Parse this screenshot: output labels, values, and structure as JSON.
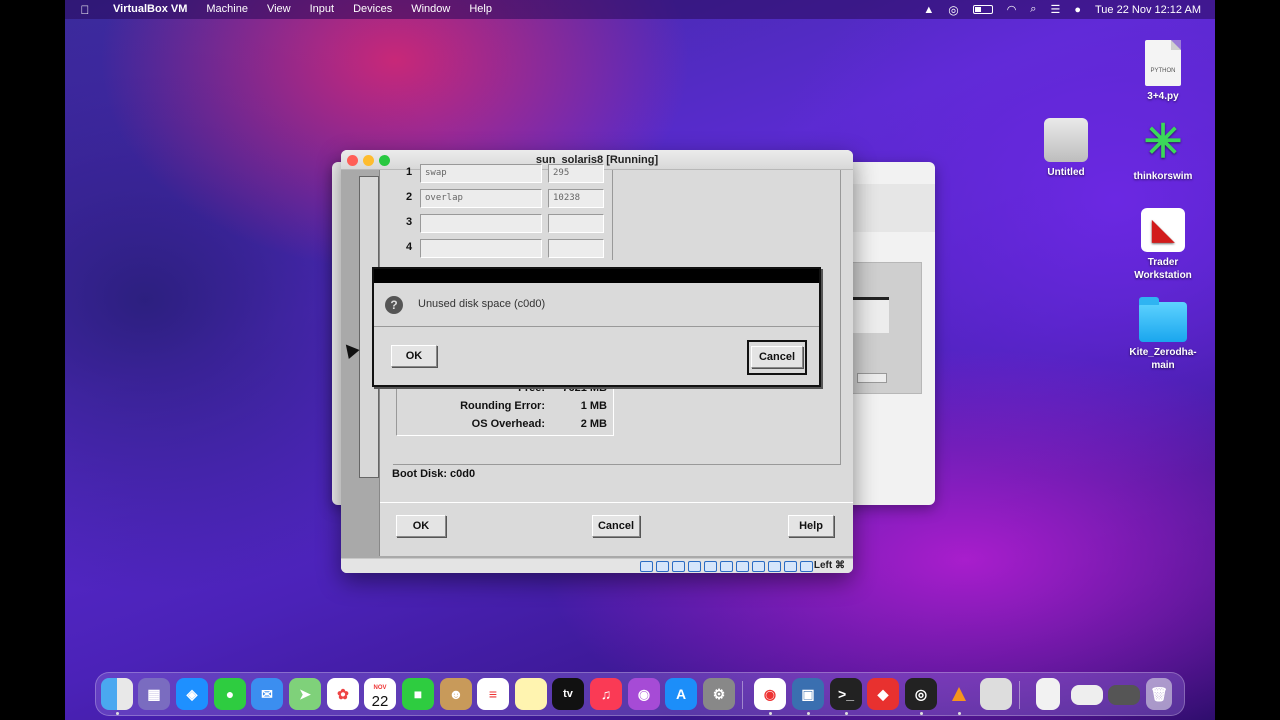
{
  "menubar": {
    "app_name": "VirtualBox VM",
    "menus": [
      "Machine",
      "View",
      "Input",
      "Devices",
      "Window",
      "Help"
    ],
    "clock": "Tue 22 Nov  12:12 AM"
  },
  "desktop_icons": [
    {
      "label": "3+4.py",
      "kind": "python-file-icon",
      "badge": "PYTHON"
    },
    {
      "label": "Untitled",
      "kind": "disk-icon"
    },
    {
      "label": "thinkorswim",
      "kind": "thinkorswim-icon"
    },
    {
      "label": "Trader Workstation",
      "kind": "tws-icon"
    },
    {
      "label": "Kite_Zerodha-main",
      "kind": "folder-icon"
    }
  ],
  "vm_window": {
    "title": "sun_solaris8 [Running]",
    "host_key": "Left ⌘"
  },
  "partitions": [
    {
      "num": "1",
      "name": "swap",
      "size": "295"
    },
    {
      "num": "2",
      "name": "overlap",
      "size": "10238"
    },
    {
      "num": "3",
      "name": "",
      "size": ""
    },
    {
      "num": "4",
      "name": "",
      "size": ""
    }
  ],
  "summary": [
    {
      "label": "Free:",
      "value": "7621 MB"
    },
    {
      "label": "Rounding Error:",
      "value": "1 MB"
    },
    {
      "label": "OS Overhead:",
      "value": "2 MB"
    }
  ],
  "boot_disk": "Boot Disk: c0d0",
  "buttons": {
    "ok": "OK",
    "cancel": "Cancel",
    "help": "Help"
  },
  "dialog": {
    "message": "Unused disk space (c0d0)",
    "ok": "OK",
    "cancel": "Cancel"
  },
  "dock": {
    "calendar_month": "NOV",
    "calendar_day": "22",
    "tv_label": "tv",
    "items": [
      "finder-icon",
      "launchpad-icon",
      "safari-icon",
      "messages-icon",
      "mail-icon",
      "maps-icon",
      "photos-icon",
      "calendar-icon",
      "facetime-icon",
      "contacts-icon",
      "reminders-icon",
      "notes-icon",
      "tv-icon",
      "music-icon",
      "podcasts-icon",
      "app-store-icon",
      "system-preferences-icon",
      "chrome-icon",
      "virtualbox-icon",
      "terminal-icon",
      "anydesk-icon",
      "obs-icon",
      "vlc-icon",
      "screenshot-icon",
      "document-icon",
      "window-thumb-icon",
      "window-thumb-2-icon",
      "trash-icon"
    ]
  }
}
